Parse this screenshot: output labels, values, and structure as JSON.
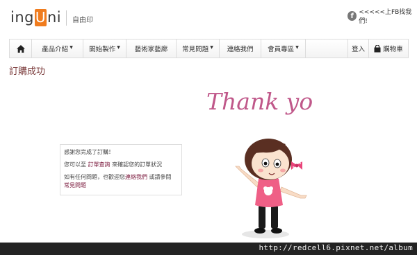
{
  "brand": {
    "logo_pre": "ing",
    "logo_u": "U",
    "logo_post": "ni",
    "tagline": "自由印",
    "accent": "#f07c1e"
  },
  "social": {
    "icon": "facebook-icon",
    "text": "<<<<<上FB找我們!"
  },
  "nav": {
    "home_icon": "home-icon",
    "items": [
      {
        "label": "產品介紹",
        "dropdown": true
      },
      {
        "label": "開始製作",
        "dropdown": true
      },
      {
        "label": "藝術家藝廊",
        "dropdown": false
      },
      {
        "label": "常見問題",
        "dropdown": true
      },
      {
        "label": "連絡我們",
        "dropdown": false
      },
      {
        "label": "會員專區",
        "dropdown": true
      }
    ],
    "login": "登入",
    "cart_icon": "shopping-bag-icon",
    "cart": "購物車"
  },
  "page": {
    "title": "訂購成功",
    "title_color": "#7a3a3a"
  },
  "illustration": {
    "headline": "Thank you!",
    "headline_color": "#c0588a"
  },
  "message": {
    "line1": "感謝您完成了訂購！",
    "line2_pre": "您可以至",
    "line2_link": "訂單查詢",
    "line2_post": "來確認您的訂單狀況",
    "line3_pre": "如有任何問題，也歡迎您",
    "line3_link": "連絡我們",
    "line3_mid": "或請參閱",
    "line3_link2": "常見問題",
    "link_color": "#7b1a3d"
  },
  "watermark": "http://redcell6.pixnet.net/album"
}
